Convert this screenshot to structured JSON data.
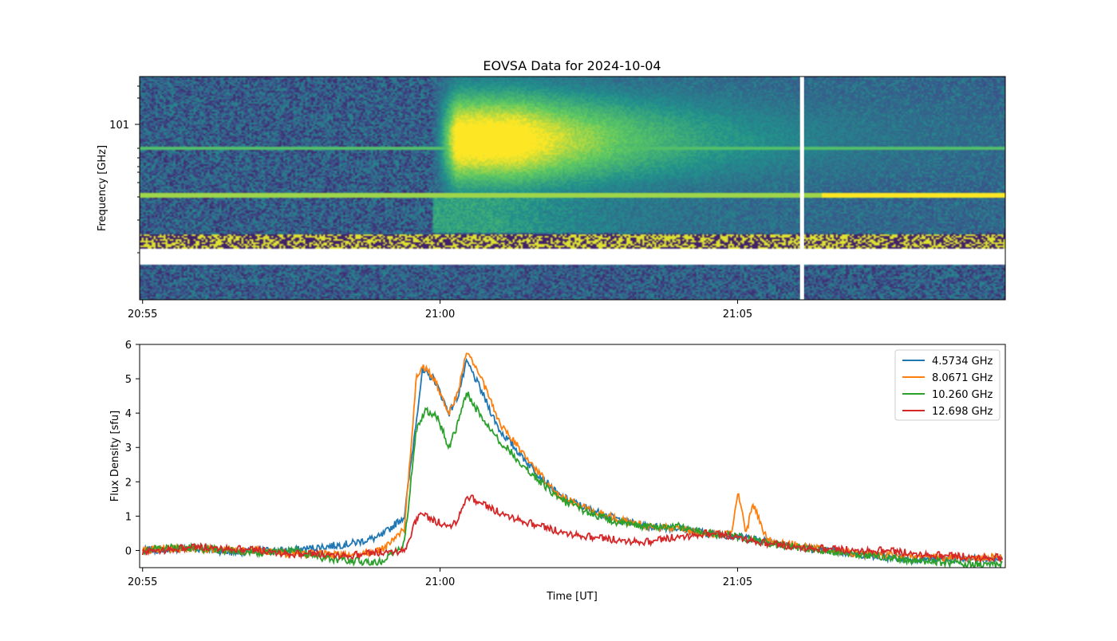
{
  "chart_data": [
    {
      "type": "heatmap",
      "title": "EOVSA Data for 2024-10-04",
      "ylabel": "Frequency [GHz]",
      "yscale": "log",
      "xticks": [
        "20:55",
        "21:00",
        "21:05"
      ],
      "yticks": [
        "10^1"
      ],
      "colormap": "viridis",
      "description_bands": {
        "flare_start": "21:00",
        "flare_peak": "21:01",
        "data_gap": "21:06"
      }
    },
    {
      "type": "line",
      "xlabel": "Time [UT]",
      "ylabel": "Flux Density [sfu]",
      "xticks": [
        "20:55",
        "21:00",
        "21:05"
      ],
      "yticks": [
        0,
        1,
        2,
        3,
        4,
        5,
        6
      ],
      "ylim": [
        -0.5,
        6
      ],
      "xlim_minutes": [
        -0.05,
        14.5
      ],
      "legend_position": "top-right",
      "series": [
        {
          "name": "4.5734 GHz",
          "color": "#1f77b4",
          "points": [
            [
              0,
              0.0
            ],
            [
              1,
              0.05
            ],
            [
              2,
              0.05
            ],
            [
              3,
              -0.05
            ],
            [
              4,
              0.0
            ],
            [
              5,
              0.0
            ],
            [
              6,
              0.1
            ],
            [
              7,
              0.2
            ],
            [
              8,
              0.4
            ],
            [
              8.8,
              1.0
            ],
            [
              9.4,
              5.2
            ],
            [
              9.8,
              5.0
            ],
            [
              10.3,
              4.0
            ],
            [
              10.6,
              4.5
            ],
            [
              10.9,
              5.5
            ],
            [
              11.3,
              4.8
            ],
            [
              12,
              3.5
            ],
            [
              13,
              2.5
            ],
            [
              14,
              1.6
            ],
            [
              15,
              1.2
            ],
            [
              16,
              0.9
            ],
            [
              17,
              0.7
            ],
            [
              18,
              0.65
            ],
            [
              19,
              0.5
            ],
            [
              20,
              0.4
            ],
            [
              21,
              0.3
            ],
            [
              22,
              0.1
            ],
            [
              23,
              0.0
            ],
            [
              24,
              -0.1
            ],
            [
              25,
              -0.2
            ],
            [
              26,
              -0.25
            ],
            [
              27,
              -0.25
            ],
            [
              28,
              -0.25
            ]
          ]
        },
        {
          "name": "8.0671 GHz",
          "color": "#ff7f0e",
          "points": [
            [
              0,
              0.0
            ],
            [
              1,
              0.05
            ],
            [
              2,
              0.05
            ],
            [
              3,
              0.0
            ],
            [
              4,
              0.0
            ],
            [
              5,
              -0.1
            ],
            [
              6,
              -0.1
            ],
            [
              7,
              -0.15
            ],
            [
              8,
              0.0
            ],
            [
              8.8,
              0.6
            ],
            [
              9.2,
              5.0
            ],
            [
              9.4,
              5.4
            ],
            [
              9.8,
              5.0
            ],
            [
              10.3,
              4.0
            ],
            [
              10.6,
              4.6
            ],
            [
              10.9,
              5.8
            ],
            [
              11.3,
              5.2
            ],
            [
              12,
              3.7
            ],
            [
              13,
              2.6
            ],
            [
              14,
              1.6
            ],
            [
              15,
              1.2
            ],
            [
              16,
              0.9
            ],
            [
              17,
              0.7
            ],
            [
              18,
              0.65
            ],
            [
              19,
              0.5
            ],
            [
              19.8,
              0.45
            ],
            [
              20.0,
              1.7
            ],
            [
              20.3,
              0.5
            ],
            [
              20.5,
              1.4
            ],
            [
              21,
              0.3
            ],
            [
              22,
              0.15
            ],
            [
              23,
              0.0
            ],
            [
              24,
              -0.1
            ],
            [
              25,
              -0.15
            ],
            [
              26,
              -0.2
            ],
            [
              27,
              -0.2
            ],
            [
              28,
              -0.2
            ]
          ]
        },
        {
          "name": "10.260 GHz",
          "color": "#2ca02c",
          "points": [
            [
              0,
              0.0
            ],
            [
              1,
              0.1
            ],
            [
              2,
              0.05
            ],
            [
              3,
              0.0
            ],
            [
              4,
              -0.05
            ],
            [
              5,
              0.0
            ],
            [
              6,
              -0.2
            ],
            [
              7,
              -0.3
            ],
            [
              8,
              -0.35
            ],
            [
              8.8,
              0.2
            ],
            [
              9.2,
              3.5
            ],
            [
              9.5,
              4.1
            ],
            [
              9.9,
              3.9
            ],
            [
              10.3,
              3.0
            ],
            [
              10.6,
              3.7
            ],
            [
              10.9,
              4.6
            ],
            [
              11.3,
              4.0
            ],
            [
              12,
              3.2
            ],
            [
              13,
              2.3
            ],
            [
              14,
              1.5
            ],
            [
              15,
              1.1
            ],
            [
              16,
              0.8
            ],
            [
              17,
              0.7
            ],
            [
              18,
              0.7
            ],
            [
              19,
              0.5
            ],
            [
              20,
              0.4
            ],
            [
              21,
              0.2
            ],
            [
              22,
              0.1
            ],
            [
              23,
              0.0
            ],
            [
              24,
              -0.1
            ],
            [
              25,
              -0.2
            ],
            [
              26,
              -0.3
            ],
            [
              27,
              -0.35
            ],
            [
              28,
              -0.4
            ]
          ]
        },
        {
          "name": "12.698 GHz",
          "color": "#d62728",
          "points": [
            [
              0,
              -0.05
            ],
            [
              1,
              0.05
            ],
            [
              2,
              0.1
            ],
            [
              3,
              0.05
            ],
            [
              4,
              0.0
            ],
            [
              5,
              -0.1
            ],
            [
              6,
              -0.1
            ],
            [
              7,
              -0.15
            ],
            [
              8,
              -0.05
            ],
            [
              8.8,
              0.0
            ],
            [
              9.3,
              1.1
            ],
            [
              9.7,
              0.9
            ],
            [
              10.3,
              0.7
            ],
            [
              10.6,
              0.9
            ],
            [
              10.9,
              1.6
            ],
            [
              11.3,
              1.4
            ],
            [
              12,
              1.1
            ],
            [
              13,
              0.8
            ],
            [
              14,
              0.55
            ],
            [
              15,
              0.4
            ],
            [
              16,
              0.3
            ],
            [
              17,
              0.25
            ],
            [
              18,
              0.4
            ],
            [
              19,
              0.5
            ],
            [
              20,
              0.4
            ],
            [
              21,
              0.2
            ],
            [
              22,
              0.1
            ],
            [
              23,
              0.05
            ],
            [
              24,
              0.0
            ],
            [
              25,
              0.0
            ],
            [
              26,
              -0.1
            ],
            [
              27,
              -0.15
            ],
            [
              28,
              -0.2
            ]
          ]
        }
      ]
    }
  ]
}
